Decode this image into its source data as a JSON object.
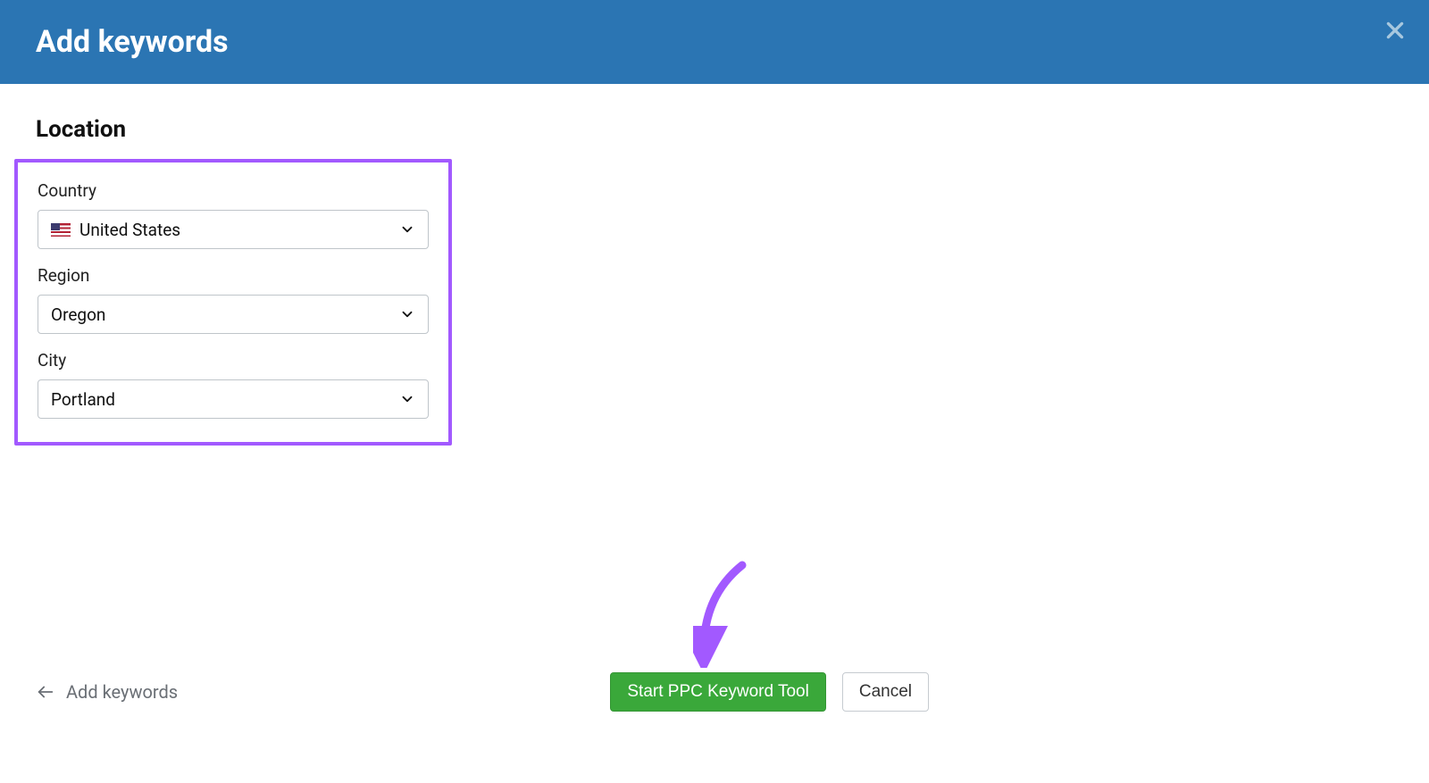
{
  "header": {
    "title": "Add keywords"
  },
  "section": {
    "title": "Location"
  },
  "fields": {
    "country": {
      "label": "Country",
      "value": "United States"
    },
    "region": {
      "label": "Region",
      "value": "Oregon"
    },
    "city": {
      "label": "City",
      "value": "Portland"
    }
  },
  "footer": {
    "back_label": "Add keywords",
    "primary_label": "Start PPC Keyword Tool",
    "cancel_label": "Cancel"
  }
}
